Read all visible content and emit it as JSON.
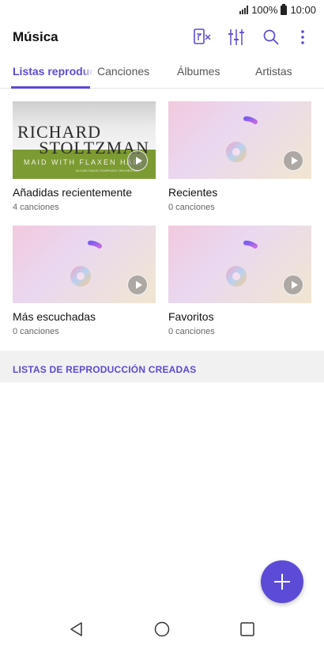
{
  "status_bar": {
    "battery": "100%",
    "time": "10:00"
  },
  "app_bar": {
    "title": "Música",
    "actions": [
      "playlist-clear-icon",
      "equalizer-icon",
      "search-icon",
      "more-vert-icon"
    ]
  },
  "tabs": [
    {
      "label": "Listas reproducción",
      "active": true
    },
    {
      "label": "Canciones",
      "active": false
    },
    {
      "label": "Álbumes",
      "active": false
    },
    {
      "label": "Artistas",
      "active": false
    }
  ],
  "playlists": [
    {
      "title": "Añadidas recientemente",
      "count": "4 canciones",
      "art": "album-cover"
    },
    {
      "title": "Recientes",
      "count": "0 canciones",
      "art": "music-note"
    },
    {
      "title": "Más escuchadas",
      "count": "0 canciones",
      "art": "music-note"
    },
    {
      "title": "Favoritos",
      "count": "0 canciones",
      "art": "music-note"
    }
  ],
  "album_cover": {
    "line1": "RICHARD",
    "line2": "STOLTZMAN",
    "subtitle": "MAID WITH FLAXEN HAIR",
    "small_text": "SLOVAK RADIO SYMPHONY ORCHESTRA"
  },
  "created_section": {
    "label": "LISTAS DE REPRODUCCIÓN CREADAS"
  },
  "fab": {
    "icon": "add-icon"
  },
  "colors": {
    "accent": "#5b4bd6",
    "section_bg": "#f1f1f1"
  }
}
